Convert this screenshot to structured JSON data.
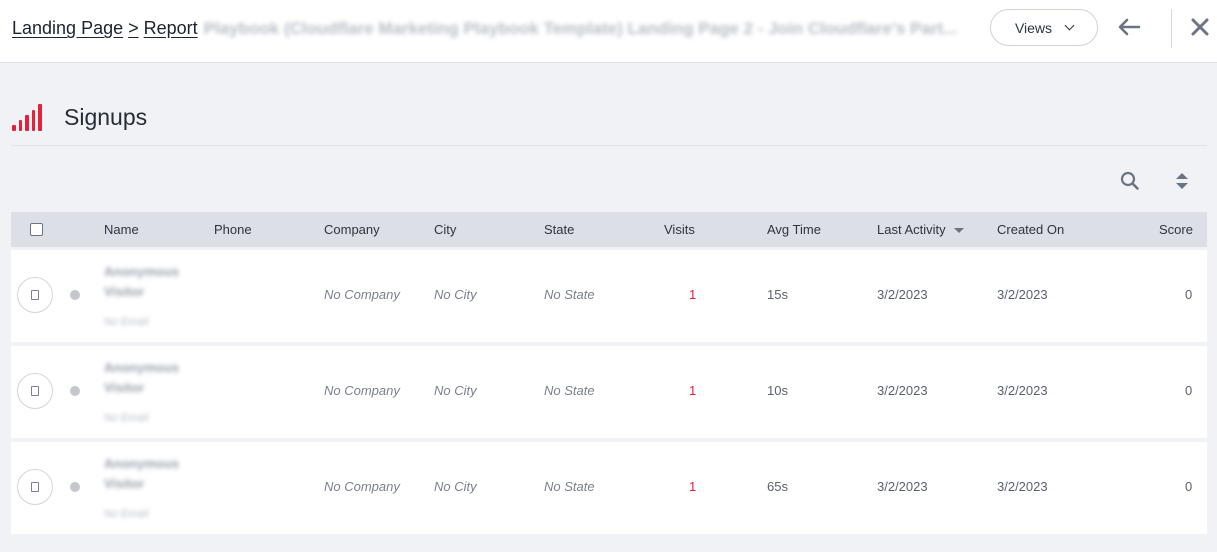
{
  "header": {
    "breadcrumb_root": "Landing Page",
    "breadcrumb_sep": ">",
    "breadcrumb_current": "Report",
    "report_name": "Playbook (Cloudflare Marketing Playbook Template) Landing Page 2 - Join Cloudflare's Part...",
    "views_label": "Views"
  },
  "section": {
    "title": "Signups"
  },
  "table": {
    "columns": {
      "name": "Name",
      "phone": "Phone",
      "company": "Company",
      "city": "City",
      "state": "State",
      "visits": "Visits",
      "avg_time": "Avg Time",
      "last_activity": "Last Activity",
      "created_on": "Created On",
      "score": "Score"
    },
    "rows": [
      {
        "name": "Anonymous Visitor",
        "email": "No Email",
        "phone": "",
        "company": "No Company",
        "city": "No City",
        "state": "No State",
        "visits": "1",
        "avg_time": "15s",
        "last_activity": "3/2/2023",
        "created_on": "3/2/2023",
        "score": "0"
      },
      {
        "name": "Anonymous Visitor",
        "email": "No Email",
        "phone": "",
        "company": "No Company",
        "city": "No City",
        "state": "No State",
        "visits": "1",
        "avg_time": "10s",
        "last_activity": "3/2/2023",
        "created_on": "3/2/2023",
        "score": "0"
      },
      {
        "name": "Anonymous Visitor",
        "email": "No Email",
        "phone": "",
        "company": "No Company",
        "city": "No City",
        "state": "No State",
        "visits": "1",
        "avg_time": "65s",
        "last_activity": "3/2/2023",
        "created_on": "3/2/2023",
        "score": "0"
      }
    ]
  },
  "icons": {
    "section": "signal-bars-icon",
    "search": "search-icon",
    "sort": "sort-icon",
    "back": "arrow-left-icon",
    "close": "close-icon"
  },
  "colors": {
    "accent": "#e1223a",
    "header_bg": "#dcdfe5",
    "page_bg": "#f1f2f5"
  }
}
